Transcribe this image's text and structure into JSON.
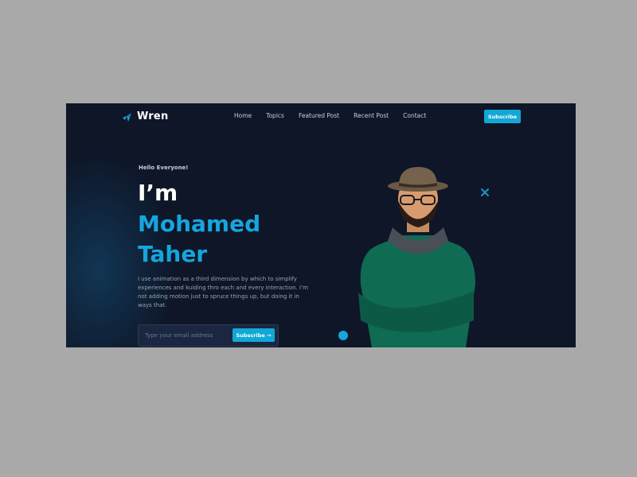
{
  "brand": {
    "name": "Wren",
    "icon": "wren-logo-icon"
  },
  "nav": {
    "items": [
      "Home",
      "Topics",
      "Featured Post",
      "Recent Post",
      "Contact"
    ]
  },
  "header": {
    "subscribe_label": "Subscribe"
  },
  "hero": {
    "greeting": "Hello Everyone!",
    "title_line1": "I’m",
    "title_name": "Mohamed Taher",
    "description": "I use animation as a third dimension by which to simplify experiences and kuiding thro each and every interaction. I’m not adding motion just to spruce things up, but doing it in ways that.",
    "email_placeholder": "Type your email address",
    "email_button_label": "Subscribe →"
  },
  "colors": {
    "background": "#0e1628",
    "accent": "#15a6dd",
    "text": "#ffffff"
  }
}
